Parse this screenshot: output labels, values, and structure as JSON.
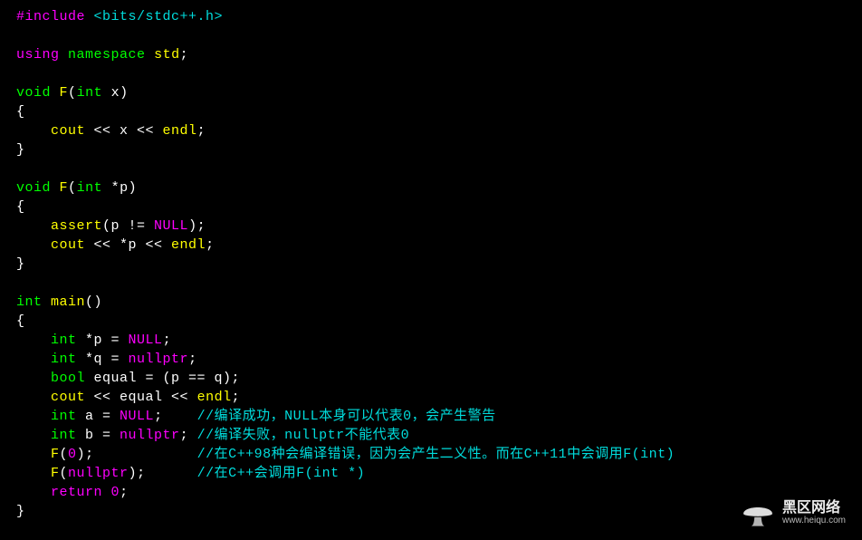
{
  "lines": [
    {
      "segs": [
        {
          "cls": "magenta",
          "t": "#include"
        },
        {
          "cls": "white",
          "t": " "
        },
        {
          "cls": "cyan",
          "t": "<bits/stdc++.h>"
        }
      ]
    },
    {
      "segs": []
    },
    {
      "segs": [
        {
          "cls": "magenta",
          "t": "using"
        },
        {
          "cls": "white",
          "t": " "
        },
        {
          "cls": "green",
          "t": "namespace"
        },
        {
          "cls": "white",
          "t": " "
        },
        {
          "cls": "yellow",
          "t": "std"
        },
        {
          "cls": "white",
          "t": ";"
        }
      ]
    },
    {
      "segs": []
    },
    {
      "segs": [
        {
          "cls": "green",
          "t": "void"
        },
        {
          "cls": "white",
          "t": " "
        },
        {
          "cls": "yellow",
          "t": "F"
        },
        {
          "cls": "white",
          "t": "("
        },
        {
          "cls": "green",
          "t": "int"
        },
        {
          "cls": "white",
          "t": " x)"
        }
      ]
    },
    {
      "segs": [
        {
          "cls": "white",
          "t": "{"
        }
      ]
    },
    {
      "segs": [
        {
          "cls": "white",
          "t": "    "
        },
        {
          "cls": "yellow",
          "t": "cout"
        },
        {
          "cls": "white",
          "t": " << x << "
        },
        {
          "cls": "yellow",
          "t": "endl"
        },
        {
          "cls": "white",
          "t": ";"
        }
      ]
    },
    {
      "segs": [
        {
          "cls": "white",
          "t": "}"
        }
      ]
    },
    {
      "segs": []
    },
    {
      "segs": [
        {
          "cls": "green",
          "t": "void"
        },
        {
          "cls": "white",
          "t": " "
        },
        {
          "cls": "yellow",
          "t": "F"
        },
        {
          "cls": "white",
          "t": "("
        },
        {
          "cls": "green",
          "t": "int"
        },
        {
          "cls": "white",
          "t": " *p)"
        }
      ]
    },
    {
      "segs": [
        {
          "cls": "white",
          "t": "{"
        }
      ]
    },
    {
      "segs": [
        {
          "cls": "white",
          "t": "    "
        },
        {
          "cls": "yellow",
          "t": "assert"
        },
        {
          "cls": "white",
          "t": "(p != "
        },
        {
          "cls": "magenta",
          "t": "NULL"
        },
        {
          "cls": "white",
          "t": ");"
        }
      ]
    },
    {
      "segs": [
        {
          "cls": "white",
          "t": "    "
        },
        {
          "cls": "yellow",
          "t": "cout"
        },
        {
          "cls": "white",
          "t": " << *p << "
        },
        {
          "cls": "yellow",
          "t": "endl"
        },
        {
          "cls": "white",
          "t": ";"
        }
      ]
    },
    {
      "segs": [
        {
          "cls": "white",
          "t": "}"
        }
      ]
    },
    {
      "segs": []
    },
    {
      "segs": [
        {
          "cls": "green",
          "t": "int"
        },
        {
          "cls": "white",
          "t": " "
        },
        {
          "cls": "yellow",
          "t": "main"
        },
        {
          "cls": "white",
          "t": "()"
        }
      ]
    },
    {
      "segs": [
        {
          "cls": "white",
          "t": "{"
        }
      ]
    },
    {
      "segs": [
        {
          "cls": "white",
          "t": "    "
        },
        {
          "cls": "green",
          "t": "int"
        },
        {
          "cls": "white",
          "t": " *p = "
        },
        {
          "cls": "magenta",
          "t": "NULL"
        },
        {
          "cls": "white",
          "t": ";"
        }
      ]
    },
    {
      "segs": [
        {
          "cls": "white",
          "t": "    "
        },
        {
          "cls": "green",
          "t": "int"
        },
        {
          "cls": "white",
          "t": " *q = "
        },
        {
          "cls": "magenta",
          "t": "nullptr"
        },
        {
          "cls": "white",
          "t": ";"
        }
      ]
    },
    {
      "segs": [
        {
          "cls": "white",
          "t": "    "
        },
        {
          "cls": "green",
          "t": "bool"
        },
        {
          "cls": "white",
          "t": " equal = (p == q);"
        }
      ]
    },
    {
      "segs": [
        {
          "cls": "white",
          "t": "    "
        },
        {
          "cls": "yellow",
          "t": "cout"
        },
        {
          "cls": "white",
          "t": " << equal << "
        },
        {
          "cls": "yellow",
          "t": "endl"
        },
        {
          "cls": "white",
          "t": ";"
        }
      ]
    },
    {
      "segs": [
        {
          "cls": "white",
          "t": "    "
        },
        {
          "cls": "green",
          "t": "int"
        },
        {
          "cls": "white",
          "t": " a = "
        },
        {
          "cls": "magenta",
          "t": "NULL"
        },
        {
          "cls": "white",
          "t": ";    "
        },
        {
          "cls": "cyan",
          "t": "//编译成功，NULL本身可以代表0，会产生警告"
        }
      ]
    },
    {
      "segs": [
        {
          "cls": "white",
          "t": "    "
        },
        {
          "cls": "green",
          "t": "int"
        },
        {
          "cls": "white",
          "t": " b = "
        },
        {
          "cls": "magenta",
          "t": "nullptr"
        },
        {
          "cls": "white",
          "t": "; "
        },
        {
          "cls": "cyan",
          "t": "//编译失败，nullptr不能代表0"
        }
      ]
    },
    {
      "segs": [
        {
          "cls": "white",
          "t": "    "
        },
        {
          "cls": "yellow",
          "t": "F"
        },
        {
          "cls": "white",
          "t": "("
        },
        {
          "cls": "magenta",
          "t": "0"
        },
        {
          "cls": "white",
          "t": ");            "
        },
        {
          "cls": "cyan",
          "t": "//在C++98种会编译错误，因为会产生二义性。而在C++11中会调用F(int)"
        }
      ]
    },
    {
      "segs": [
        {
          "cls": "white",
          "t": "    "
        },
        {
          "cls": "yellow",
          "t": "F"
        },
        {
          "cls": "white",
          "t": "("
        },
        {
          "cls": "magenta",
          "t": "nullptr"
        },
        {
          "cls": "white",
          "t": ");      "
        },
        {
          "cls": "cyan",
          "t": "//在C++会调用F(int *)"
        }
      ]
    },
    {
      "segs": [
        {
          "cls": "white",
          "t": "    "
        },
        {
          "cls": "magenta",
          "t": "return"
        },
        {
          "cls": "white",
          "t": " "
        },
        {
          "cls": "magenta",
          "t": "0"
        },
        {
          "cls": "white",
          "t": ";"
        }
      ]
    },
    {
      "segs": [
        {
          "cls": "white",
          "t": "}"
        }
      ]
    }
  ],
  "watermark": {
    "label": "黑区网络",
    "url": "www.heiqu.com",
    "icon_fill": "#f0f0f0",
    "icon_stem": "#c4c4c4"
  }
}
